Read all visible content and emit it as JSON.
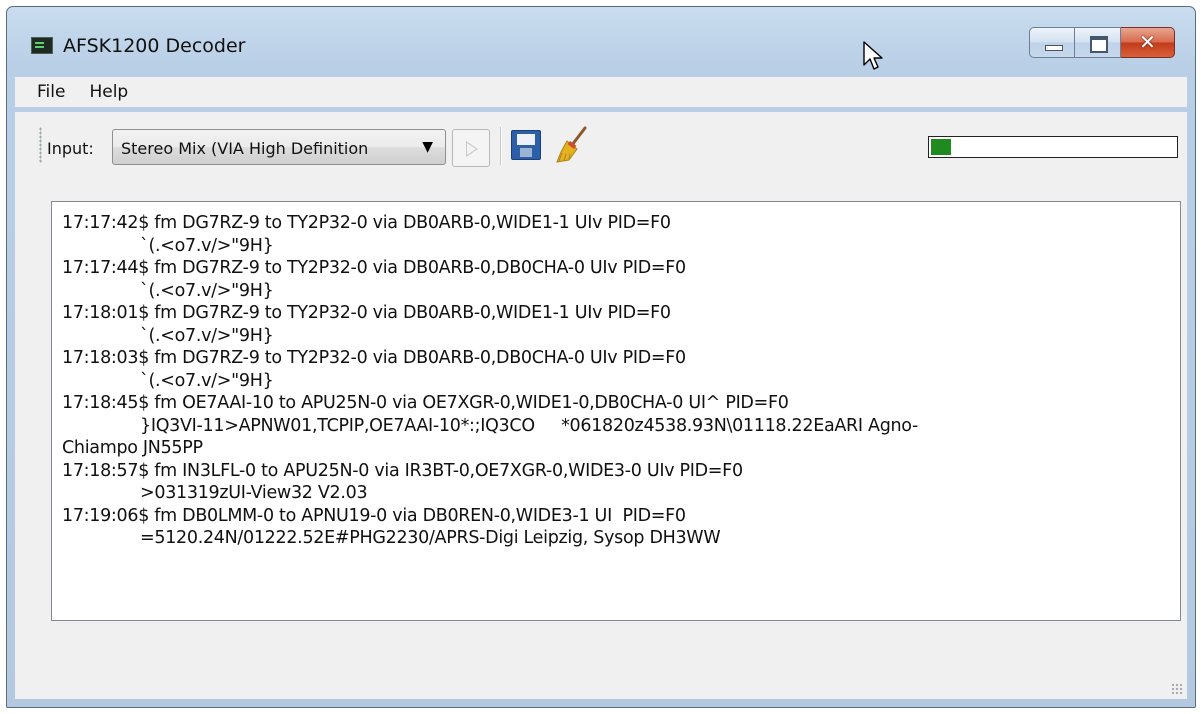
{
  "window": {
    "title": "AFSK1200 Decoder",
    "caption": {
      "close_label": "✕"
    }
  },
  "menu": {
    "items": [
      {
        "label": "File"
      },
      {
        "label": "Help"
      }
    ]
  },
  "toolbar": {
    "input_label": "Input:",
    "input_device": "Stereo Mix (VIA High Definition",
    "level_fraction": 0.08,
    "level_color": "#1f8a1f",
    "play_icon": "play-icon",
    "save_icon": "floppy-disk-icon",
    "clear_icon": "broom-icon"
  },
  "log": {
    "lines": [
      {
        "text": "17:17:42$ fm DG7RZ-9 to TY2P32-0 via DB0ARB-0,WIDE1-1 UIv PID=F0",
        "indent": false
      },
      {
        "text": "`(.<o7.v/>\"9H}",
        "indent": true
      },
      {
        "text": "17:17:44$ fm DG7RZ-9 to TY2P32-0 via DB0ARB-0,DB0CHA-0 UIv PID=F0",
        "indent": false
      },
      {
        "text": "`(.<o7.v/>\"9H}",
        "indent": true
      },
      {
        "text": "17:18:01$ fm DG7RZ-9 to TY2P32-0 via DB0ARB-0,WIDE1-1 UIv PID=F0",
        "indent": false
      },
      {
        "text": "`(.<o7.v/>\"9H}",
        "indent": true
      },
      {
        "text": "17:18:03$ fm DG7RZ-9 to TY2P32-0 via DB0ARB-0,DB0CHA-0 UIv PID=F0",
        "indent": false
      },
      {
        "text": "`(.<o7.v/>\"9H}",
        "indent": true
      },
      {
        "text": "17:18:45$ fm OE7AAI-10 to APU25N-0 via OE7XGR-0,WIDE1-0,DB0CHA-0 UI^ PID=F0",
        "indent": false
      },
      {
        "text": "}IQ3VI-11>APNW01,TCPIP,OE7AAI-10*:;IQ3CO     *061820z4538.93N\\01118.22EaARI Agno-",
        "indent": true
      },
      {
        "text": "Chiampo JN55PP",
        "indent": false
      },
      {
        "text": "17:18:57$ fm IN3LFL-0 to APU25N-0 via IR3BT-0,OE7XGR-0,WIDE3-0 UIv PID=F0",
        "indent": false
      },
      {
        "text": ">031319zUI-View32 V2.03",
        "indent": true
      },
      {
        "text": "17:19:06$ fm DB0LMM-0 to APNU19-0 via DB0REN-0,WIDE3-1 UI  PID=F0",
        "indent": false
      },
      {
        "text": "=5120.24N/01222.52E#PHG2230/APRS-Digi Leipzig, Sysop DH3WW",
        "indent": true
      }
    ]
  }
}
